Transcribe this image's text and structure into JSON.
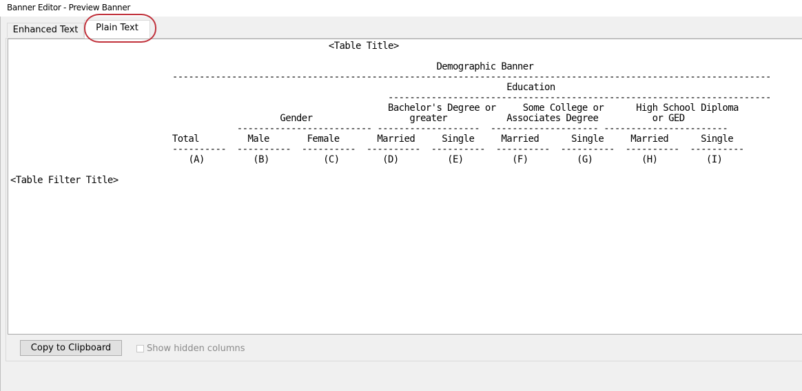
{
  "window": {
    "title": "Banner Editor - Preview Banner"
  },
  "tabs": [
    {
      "label": "Enhanced Text",
      "selected": false
    },
    {
      "label": "Plain Text",
      "selected": true
    }
  ],
  "preview": {
    "lines": [
      "                                                           <Table Title>",
      "",
      "                                                                               Demographic Banner",
      "                              ---------------------------------------------------------------------------------------------------------------",
      "                                                                                            Education",
      "                                                                      -----------------------------------------------------------------------",
      "                                                                      Bachelor's Degree or     Some College or      High School Diploma",
      "                                                  Gender                  greater           Associates Degree          or GED",
      "                                          ------------------------- -------------------  -------------------- -----------------------",
      "                              Total         Male       Female       Married     Single     Married      Single     Married      Single",
      "                              ----------  ----------  ----------  ----------  ----------  ----------  ----------  ----------  ----------",
      "                                 (A)         (B)          (C)        (D)         (E)         (F)         (G)         (H)         (I)",
      "",
      "<Table Filter Title>"
    ]
  },
  "footer": {
    "copy_button_label": "Copy to Clipboard",
    "show_hidden_label": "Show hidden columns",
    "show_hidden_checked": false
  }
}
